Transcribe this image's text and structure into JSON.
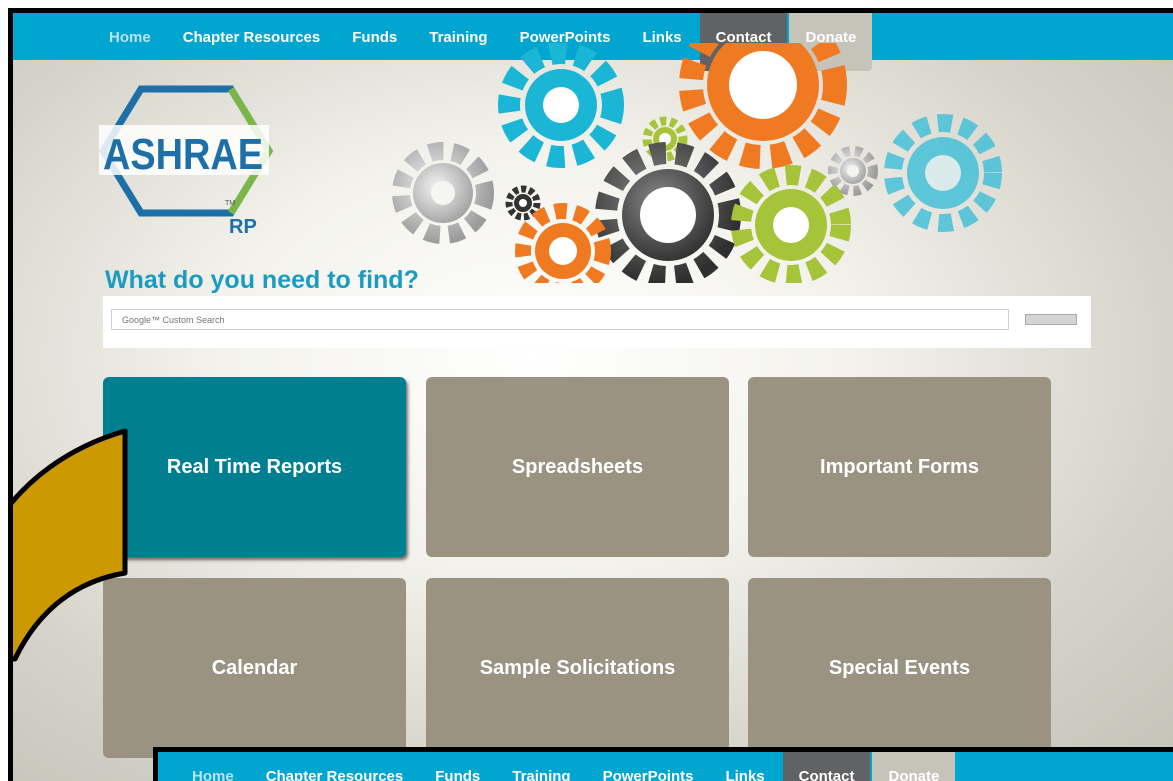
{
  "nav": {
    "items": [
      {
        "label": "Home"
      },
      {
        "label": "Chapter Resources"
      },
      {
        "label": "Funds"
      },
      {
        "label": "Training"
      },
      {
        "label": "PowerPoints"
      },
      {
        "label": "Links"
      },
      {
        "label": "Contact"
      },
      {
        "label": "Donate"
      }
    ]
  },
  "logo": {
    "name": "ASHRAE",
    "tm": "TM",
    "sub": "RP"
  },
  "search": {
    "title": "What do you need to find?",
    "placeholder": "Google™ Custom Search"
  },
  "tiles": [
    {
      "label": "Real Time Reports"
    },
    {
      "label": "Spreadsheets"
    },
    {
      "label": "Important Forms"
    },
    {
      "label": "Calendar"
    },
    {
      "label": "Sample Solicitations"
    },
    {
      "label": "Special Events"
    }
  ],
  "colors": {
    "nav_bar": "#00a6cf",
    "contact_tab": "#616263",
    "donate_tab": "#c6c3b8",
    "tile": "#9a9382",
    "tile_active": "#007f91",
    "title_blue": "#1a9cc2",
    "logo_blue": "#1d6fa8",
    "logo_green": "#7ab648",
    "arrow_fill": "#cc9900"
  }
}
